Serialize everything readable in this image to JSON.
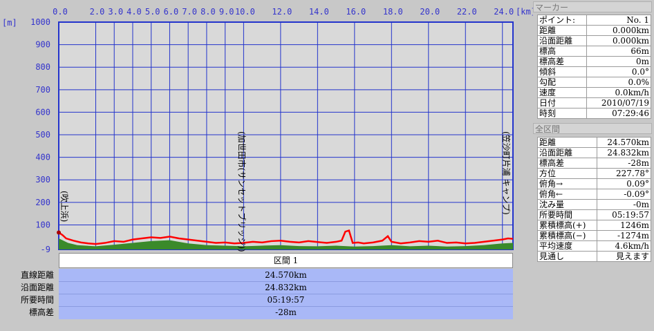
{
  "axis_units": {
    "y": "[m]",
    "x": "[km]"
  },
  "chart_data": {
    "type": "line",
    "x_ticks": [
      "0.0",
      "2.0",
      "3.0",
      "4.0",
      "5.0",
      "6.0",
      "7.0",
      "8.0",
      "9.0",
      "10.0",
      "12.0",
      "14.0",
      "16.0",
      "18.0",
      "20.0",
      "22.0",
      "24.0"
    ],
    "y_ticks": [
      "1000",
      "900",
      "800",
      "700",
      "600",
      "500",
      "400",
      "300",
      "200",
      "100",
      "-9"
    ],
    "xlim": [
      0,
      24.57
    ],
    "ylim": [
      -9,
      1000
    ],
    "grid": true,
    "series": [
      {
        "color": "#ff0000",
        "x": [
          0,
          0.2,
          0.4,
          0.8,
          1.2,
          1.6,
          2,
          2.5,
          3,
          3.5,
          4,
          4.5,
          5,
          5.5,
          6,
          6.5,
          7,
          7.5,
          8,
          8.5,
          9,
          9.5,
          10,
          10.5,
          11,
          11.5,
          12,
          12.5,
          13,
          13.5,
          14,
          14.5,
          15,
          15.3,
          15.5,
          15.7,
          15.9,
          16.2,
          16.5,
          17,
          17.5,
          17.8,
          18,
          18.5,
          19,
          19.5,
          20,
          20.5,
          21,
          21.5,
          22,
          22.5,
          23,
          23.5,
          24,
          24.3,
          24.57
        ],
        "y": [
          66,
          55,
          40,
          30,
          22,
          18,
          15,
          20,
          28,
          25,
          35,
          40,
          45,
          42,
          48,
          40,
          35,
          30,
          25,
          20,
          22,
          18,
          20,
          25,
          22,
          28,
          30,
          25,
          22,
          28,
          24,
          20,
          25,
          30,
          70,
          75,
          20,
          22,
          18,
          22,
          30,
          50,
          25,
          18,
          22,
          28,
          25,
          30,
          20,
          22,
          18,
          20,
          25,
          30,
          35,
          40,
          38
        ]
      },
      {
        "color": "#3a8a2a",
        "x": [
          0,
          0.5,
          1,
          2,
          3,
          4,
          5,
          6,
          7,
          8,
          9,
          10,
          11,
          12,
          13,
          14,
          15,
          16,
          17,
          18,
          19,
          20,
          21,
          22,
          23,
          24,
          24.57
        ],
        "y": [
          40,
          20,
          10,
          5,
          12,
          20,
          28,
          32,
          18,
          10,
          8,
          5,
          8,
          10,
          6,
          5,
          8,
          4,
          6,
          10,
          5,
          8,
          4,
          6,
          10,
          18,
          20
        ]
      }
    ],
    "annotations": [
      {
        "text": "(吹上浜)",
        "x": 0.3
      },
      {
        "text": "(加世田市(サンセットブリッジ))",
        "x": 9.9
      },
      {
        "text": "(笠沙町片浦 キャンプ)",
        "x": 24.2
      }
    ]
  },
  "marker_panel": {
    "header": "マーカー",
    "rows": [
      {
        "label": "ポイント:",
        "value": "No. 1"
      },
      {
        "label": "距離",
        "value": "0.000km"
      },
      {
        "label": "沿面距離",
        "value": "0.000km"
      },
      {
        "label": "標高",
        "value": "66m"
      },
      {
        "label": "標高差",
        "value": "0m"
      },
      {
        "label": "傾斜",
        "value": "0.0°"
      },
      {
        "label": "勾配",
        "value": "0.0%"
      },
      {
        "label": "速度",
        "value": "0.0km/h"
      },
      {
        "label": "日付",
        "value": "2010/07/19"
      },
      {
        "label": "時刻",
        "value": "07:29:46"
      }
    ]
  },
  "all_section_panel": {
    "header": "全区間",
    "rows": [
      {
        "label": "距離",
        "value": "24.570km"
      },
      {
        "label": "沿面距離",
        "value": "24.832km"
      },
      {
        "label": "標高差",
        "value": "-28m"
      },
      {
        "label": "方位",
        "value": "227.78°"
      },
      {
        "label": "俯角→",
        "value": "0.09°"
      },
      {
        "label": "俯角←",
        "value": "-0.09°"
      },
      {
        "label": "沈み量",
        "value": "-0m"
      },
      {
        "label": "所要時間",
        "value": "05:19:57"
      },
      {
        "label": "累積標高(+)",
        "value": "1246m"
      },
      {
        "label": "累積標高(−)",
        "value": "-1274m"
      },
      {
        "label": "平均速度",
        "value": "4.6km/h"
      },
      {
        "label": "見通し",
        "value": "見えます"
      }
    ]
  },
  "section_table": {
    "header": "区間 1",
    "rows": [
      {
        "label": "直線距離",
        "value": "24.570km"
      },
      {
        "label": "沿面距離",
        "value": "24.832km"
      },
      {
        "label": "所要時間",
        "value": "05:19:57"
      },
      {
        "label": "標高差",
        "value": "-28m"
      }
    ]
  }
}
